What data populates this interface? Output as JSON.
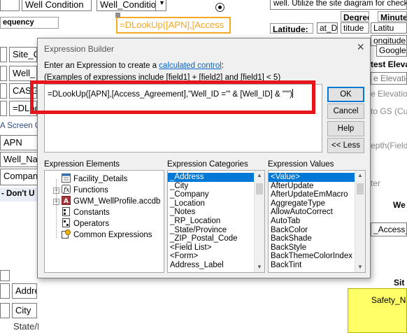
{
  "background": {
    "top_combo_1": "Well Condition",
    "top_combo_2": "Well_Conditior",
    "selected_control": "=DLookUp([APN],[Access",
    "instruction_text": "well.  Utilize the site diagram for check",
    "frequency_label": "equency",
    "degree_label": "Degree",
    "minute_label": "Minute",
    "latitude_label": "Latitude:",
    "lat_value": "at_D",
    "lat_deg": "titude",
    "lat_min": "Latitu",
    "longitude_label": "Longitude",
    "longitude_frag": "ongitude",
    "google_label": "Google",
    "left_fields": [
      "Site_C",
      "Well_",
      "CASGE",
      "=DLoo"
    ],
    "left_screen_header": "A Screen C",
    "left_list": [
      "APN",
      "Well_Na",
      "Compan"
    ],
    "dont_use": "- Don't U",
    "address_label": "Addre",
    "city_label": "City",
    "state_label": "State/Province",
    "right_labels": [
      "test Elevat",
      "e Elevation",
      "e Elevatio",
      "to GS (Cut",
      "epth(Field",
      "ter",
      "We",
      "_Access_",
      "Sit",
      "Safety_N"
    ]
  },
  "dialog": {
    "title": "Expression Builder",
    "close_icon": "×",
    "instruction_prefix": "Enter an Expression to create a ",
    "instruction_link": "calculated control",
    "instruction_suffix": ":",
    "examples": "(Examples of expressions include [field1] + [field2] and [field1] < 5)",
    "expression": "=DLookUp([APN],[Access_Agreement],\"Well_ID ='\" & [Well_ID] & \"'\")",
    "buttons": {
      "ok": "OK",
      "cancel": "Cancel",
      "help": "Help",
      "less": "<< Less"
    },
    "elements_label": "Expression Elements",
    "categories_label": "Expression Categories",
    "values_label": "Expression Values",
    "elements": [
      {
        "label": "Facility_Details",
        "icon": "form-icon",
        "expandable": false
      },
      {
        "label": "Functions",
        "icon": "functions-icon",
        "expandable": true
      },
      {
        "label": "GWM_WellProfile.accdb",
        "icon": "access-db-icon",
        "expandable": true
      },
      {
        "label": "Constants",
        "icon": "constants-icon",
        "expandable": false
      },
      {
        "label": "Operators",
        "icon": "operators-icon",
        "expandable": false
      },
      {
        "label": "Common Expressions",
        "icon": "common-expressions-icon",
        "expandable": false
      }
    ],
    "categories": [
      "_Address",
      "_City",
      "_Company",
      "_Location",
      "_Notes",
      "_RP_Location",
      "_State/Province",
      "_ZIP_Postal_Code",
      "<Field List>",
      "<Form>",
      "Address_Label"
    ],
    "values": [
      "<Value>",
      "AfterUpdate",
      "AfterUpdateEmMacro",
      "AggregateType",
      "AllowAutoCorrect",
      "AutoTab",
      "BackColor",
      "BackShade",
      "BackStyle",
      "BackThemeColorIndex",
      "BackTint"
    ],
    "selected_category": "_Address",
    "selected_value": "<Value>"
  },
  "colors": {
    "highlight": "#e8141b",
    "selection": "#0078d7",
    "link": "#0066cc",
    "yellow": "#ffff66",
    "orange_outline": "#f5a623"
  }
}
